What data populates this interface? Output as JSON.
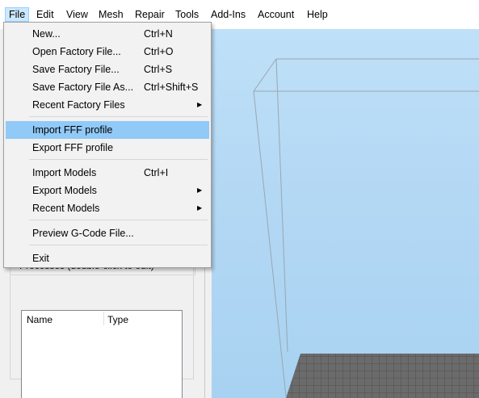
{
  "menubar": {
    "items": [
      {
        "label": "File",
        "active": true
      },
      {
        "label": "Edit"
      },
      {
        "label": "View"
      },
      {
        "label": "Mesh"
      },
      {
        "label": "Repair"
      },
      {
        "label": "Tools"
      },
      {
        "label": "Add-Ins"
      },
      {
        "label": "Account"
      },
      {
        "label": "Help"
      }
    ]
  },
  "file_menu": {
    "items": [
      {
        "label": "New...",
        "shortcut": "Ctrl+N"
      },
      {
        "label": "Open Factory File...",
        "shortcut": "Ctrl+O"
      },
      {
        "label": "Save Factory File...",
        "shortcut": "Ctrl+S"
      },
      {
        "label": "Save Factory File As...",
        "shortcut": "Ctrl+Shift+S"
      },
      {
        "label": "Recent Factory Files",
        "submenu": true
      },
      {
        "label": "Import FFF profile",
        "highlighted": true
      },
      {
        "label": "Export FFF profile"
      },
      {
        "label": "Import Models",
        "shortcut": "Ctrl+I"
      },
      {
        "label": "Export Models",
        "submenu": true
      },
      {
        "label": "Recent Models",
        "submenu": true
      },
      {
        "label": "Preview G-Code File..."
      },
      {
        "label": "Exit"
      }
    ]
  },
  "processes_panel": {
    "title": "Processes (double-click to edit)",
    "columns": [
      "Name",
      "Type"
    ],
    "rows": []
  },
  "colors": {
    "highlight": "#91c9f7",
    "menu_active": "#cce8ff",
    "viewport_sky": "#b3d8f4",
    "bed_grid": "#6a6a6a"
  }
}
